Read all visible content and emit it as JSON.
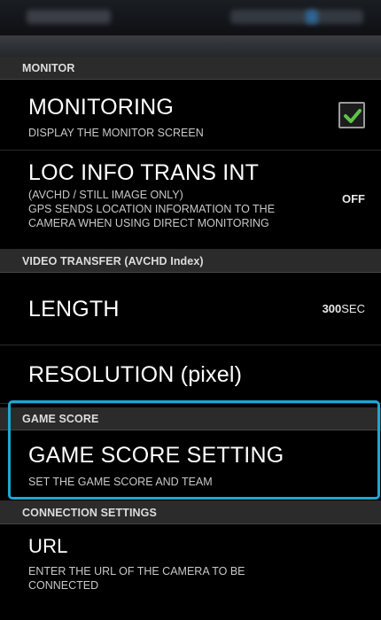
{
  "sections": {
    "monitor": "MONITOR",
    "video_transfer": "VIDEO TRANSFER (AVCHD Index)",
    "game_score": "GAME SCORE",
    "connection_settings": "CONNECTION SETTINGS"
  },
  "items": {
    "monitoring": {
      "title": "MONITORING",
      "subtitle": "DISPLAY THE MONITOR SCREEN",
      "checked": true
    },
    "loc_info": {
      "title": "LOC INFO TRANS INT",
      "subtitle": "(AVCHD / STILL IMAGE ONLY)\nGPS SENDS LOCATION INFORMATION TO THE\nCAMERA WHEN USING DIRECT MONITORING",
      "value": "OFF"
    },
    "length": {
      "title": "LENGTH",
      "value_number": "300",
      "value_unit": "SEC"
    },
    "resolution": {
      "title": "RESOLUTION (pixel)"
    },
    "game_score_setting": {
      "title": "GAME SCORE SETTING",
      "subtitle": "SET THE GAME SCORE AND TEAM"
    },
    "url": {
      "title": "URL",
      "subtitle": "ENTER THE URL OF THE CAMERA TO BE\nCONNECTED"
    }
  },
  "colors": {
    "highlight": "#1fa6d6",
    "checkbox_check": "#5cc44a"
  },
  "icons": {
    "checkbox": "check-icon"
  }
}
